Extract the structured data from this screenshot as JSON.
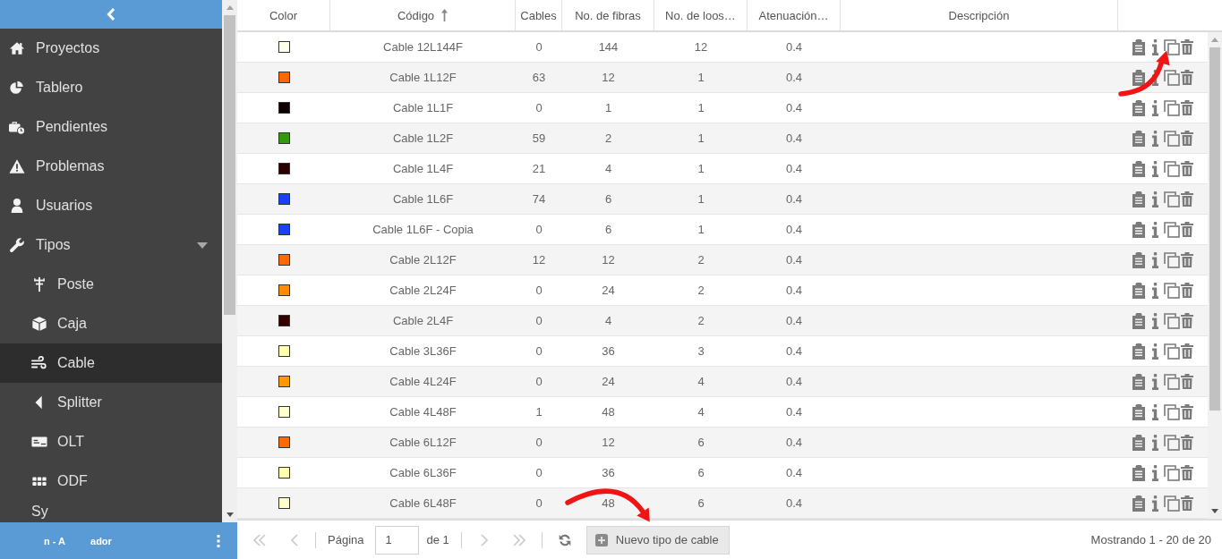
{
  "sidebar": {
    "items": [
      {
        "label": "Proyectos",
        "selected": false
      },
      {
        "label": "Tablero",
        "selected": false
      },
      {
        "label": "Pendientes",
        "selected": false
      },
      {
        "label": "Problemas",
        "selected": false
      },
      {
        "label": "Usuarios",
        "selected": false
      },
      {
        "label": "Tipos",
        "selected": false,
        "expanded": true,
        "children": [
          {
            "label": "Poste",
            "selected": false
          },
          {
            "label": "Caja",
            "selected": false
          },
          {
            "label": "Cable",
            "selected": true
          },
          {
            "label": "Splitter",
            "selected": false
          },
          {
            "label": "OLT",
            "selected": false
          },
          {
            "label": "ODF",
            "selected": false
          },
          {
            "label": "Sy",
            "selected": false
          }
        ]
      }
    ],
    "footer": {
      "user_label_parts": [
        "n - A",
        "ador"
      ]
    }
  },
  "table": {
    "columns": [
      {
        "label": "Color",
        "sorted": false
      },
      {
        "label": "Código",
        "sorted": true
      },
      {
        "label": "Cables",
        "sorted": false
      },
      {
        "label": "No. de fibras",
        "sorted": false
      },
      {
        "label": "No. de loos…",
        "sorted": false
      },
      {
        "label": "Atenuación…",
        "sorted": false
      },
      {
        "label": "Descripción",
        "sorted": false
      }
    ],
    "rows": [
      {
        "color": "#ffffee",
        "code": "Cable 12L144F",
        "cables": "0",
        "fibers": "144",
        "loose_tubes": "12",
        "attenuation": "0.4"
      },
      {
        "color": "#ff6600",
        "code": "Cable 1L12F",
        "cables": "63",
        "fibers": "12",
        "loose_tubes": "1",
        "attenuation": "0.4"
      },
      {
        "color": "#0d0000",
        "code": "Cable 1L1F",
        "cables": "0",
        "fibers": "1",
        "loose_tubes": "1",
        "attenuation": "0.4"
      },
      {
        "color": "#339911",
        "code": "Cable 1L2F",
        "cables": "59",
        "fibers": "2",
        "loose_tubes": "1",
        "attenuation": "0.4"
      },
      {
        "color": "#2a0000",
        "code": "Cable 1L4F",
        "cables": "21",
        "fibers": "4",
        "loose_tubes": "1",
        "attenuation": "0.4"
      },
      {
        "color": "#1a40ff",
        "code": "Cable 1L6F",
        "cables": "74",
        "fibers": "6",
        "loose_tubes": "1",
        "attenuation": "0.4"
      },
      {
        "color": "#1a40ff",
        "code": "Cable 1L6F - Copia",
        "cables": "0",
        "fibers": "6",
        "loose_tubes": "1",
        "attenuation": "0.4"
      },
      {
        "color": "#ff6a00",
        "code": "Cable 2L12F",
        "cables": "12",
        "fibers": "12",
        "loose_tubes": "2",
        "attenuation": "0.4"
      },
      {
        "color": "#ff8c00",
        "code": "Cable 2L24F",
        "cables": "0",
        "fibers": "24",
        "loose_tubes": "2",
        "attenuation": "0.4"
      },
      {
        "color": "#330000",
        "code": "Cable 2L4F",
        "cables": "0",
        "fibers": "4",
        "loose_tubes": "2",
        "attenuation": "0.4"
      },
      {
        "color": "#ffffb0",
        "code": "Cable 3L36F",
        "cables": "0",
        "fibers": "36",
        "loose_tubes": "3",
        "attenuation": "0.4"
      },
      {
        "color": "#ff9900",
        "code": "Cable 4L24F",
        "cables": "0",
        "fibers": "24",
        "loose_tubes": "4",
        "attenuation": "0.4"
      },
      {
        "color": "#ffffcc",
        "code": "Cable 4L48F",
        "cables": "1",
        "fibers": "48",
        "loose_tubes": "4",
        "attenuation": "0.4"
      },
      {
        "color": "#ff6a00",
        "code": "Cable 6L12F",
        "cables": "0",
        "fibers": "12",
        "loose_tubes": "6",
        "attenuation": "0.4"
      },
      {
        "color": "#ffffb0",
        "code": "Cable 6L36F",
        "cables": "0",
        "fibers": "36",
        "loose_tubes": "6",
        "attenuation": "0.4"
      },
      {
        "color": "#ffffcc",
        "code": "Cable 6L48F",
        "cables": "0",
        "fibers": "48",
        "loose_tubes": "6",
        "attenuation": "0.4"
      }
    ]
  },
  "pager": {
    "back": [
      {
        "kind": "first",
        "disabled": true
      },
      {
        "kind": "previous",
        "disabled": true
      }
    ],
    "page_label": "Página",
    "page": "1",
    "page_count": "de 1",
    "forward": [
      {
        "kind": "next",
        "disabled": true
      },
      {
        "kind": "last",
        "disabled": true
      }
    ],
    "add_button": "Nuevo tipo de cable",
    "summary": "Mostrando 1 - 20 de 20"
  },
  "annotations": [
    {
      "kind": "arrow"
    },
    {
      "kind": "arrow"
    }
  ]
}
